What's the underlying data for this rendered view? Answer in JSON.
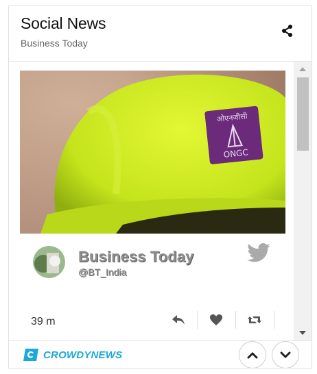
{
  "header": {
    "title": "Social News",
    "subtitle": "Business Today"
  },
  "post": {
    "image_alt": "ONGC helmet",
    "image_logo_text": "ONGC",
    "author_name": "Business Today",
    "author_handle": "@BT_India",
    "time_ago": "39 m"
  },
  "footer": {
    "brand": "CROWDYNEWS"
  },
  "colors": {
    "brand": "#1da9d7",
    "helmet": "#c9ea1c"
  },
  "icons": {
    "share": "share-icon",
    "twitter": "twitter-bird-icon",
    "reply": "reply-icon",
    "like": "heart-icon",
    "retweet": "retweet-icon",
    "up": "chevron-up-icon",
    "down": "chevron-down-icon"
  }
}
